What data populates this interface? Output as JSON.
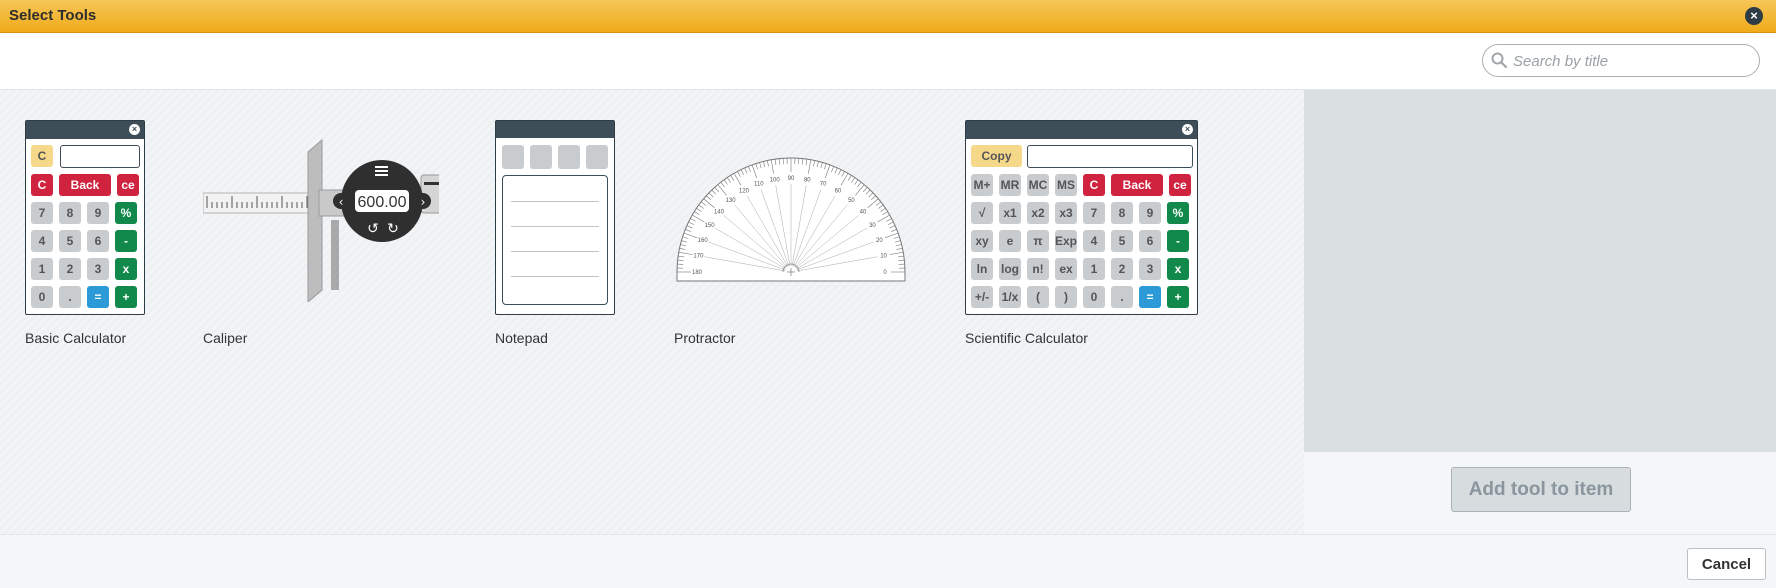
{
  "dialog": {
    "title": "Select Tools"
  },
  "search": {
    "placeholder": "Search by title",
    "value": ""
  },
  "tools": [
    {
      "label": "Basic Calculator"
    },
    {
      "label": "Caliper",
      "readout": "600.00"
    },
    {
      "label": "Notepad"
    },
    {
      "label": "Protractor"
    },
    {
      "label": "Scientific Calculator"
    }
  ],
  "basic_calc": {
    "rows": [
      [
        "C",
        "Back",
        "ce"
      ],
      [
        "7",
        "8",
        "9",
        "%"
      ],
      [
        "4",
        "5",
        "6",
        "-"
      ],
      [
        "1",
        "2",
        "3",
        "x"
      ],
      [
        "0",
        ".",
        "=",
        "+"
      ]
    ],
    "top_key": "C"
  },
  "sci_calc": {
    "top_key": "Copy",
    "rows": [
      [
        "M+",
        "MR",
        "MC",
        "MS",
        "C",
        "Back",
        "ce"
      ],
      [
        "√",
        "x1",
        "x2",
        "x3",
        "7",
        "8",
        "9",
        "%"
      ],
      [
        "xy",
        "e",
        "π",
        "Exp",
        "4",
        "5",
        "6",
        "-"
      ],
      [
        "ln",
        "log",
        "n!",
        "ex",
        "1",
        "2",
        "3",
        "x"
      ],
      [
        "+/-",
        "1/x",
        "(",
        ")",
        "0",
        ".",
        "=",
        "+"
      ]
    ]
  },
  "protractor": {
    "ticks": [
      "0",
      "10",
      "20",
      "30",
      "40",
      "50",
      "60",
      "70",
      "80",
      "90",
      "100",
      "110",
      "120",
      "130",
      "140",
      "150",
      "160",
      "170",
      "180"
    ]
  },
  "actions": {
    "add_tool": "Add tool to item",
    "cancel": "Cancel"
  }
}
